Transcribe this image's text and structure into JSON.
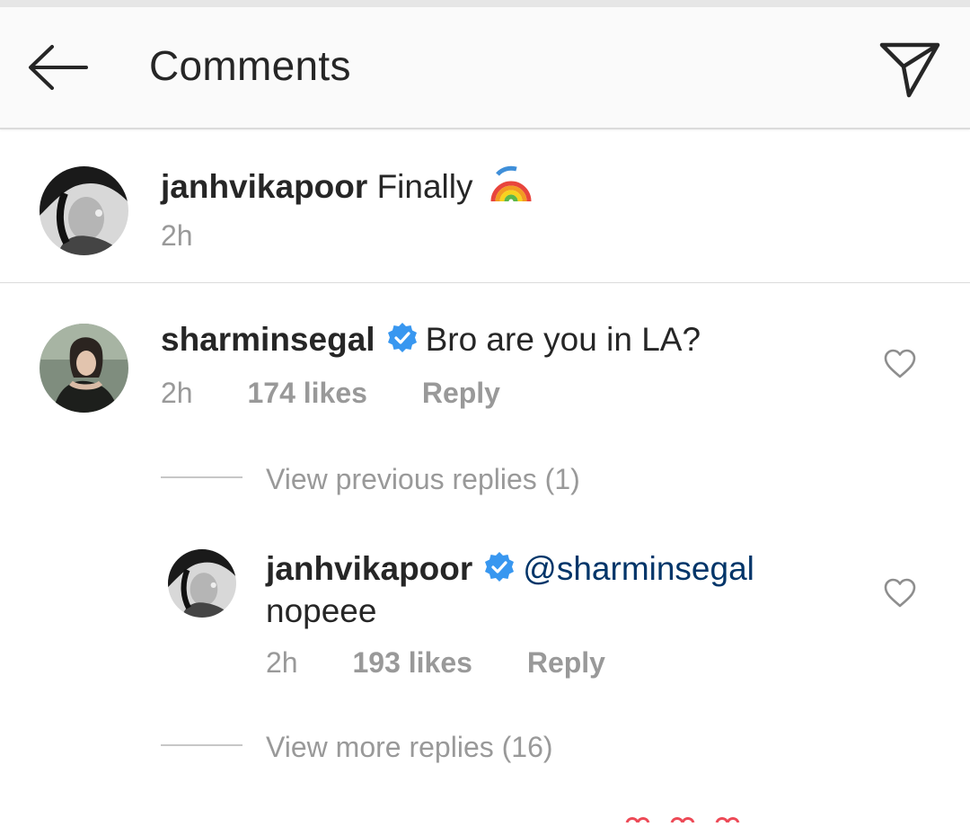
{
  "header": {
    "title": "Comments",
    "back_icon": "arrow-left-icon",
    "share_icon": "paper-plane-icon"
  },
  "caption": {
    "username": "janhvikapoor",
    "text": "Finally",
    "emoji": "rainbow-emoji",
    "time": "2h"
  },
  "comment": {
    "username": "sharminsegal",
    "verified": true,
    "text": "Bro are you in LA?",
    "time": "2h",
    "likes": "174 likes",
    "reply_label": "Reply"
  },
  "view_previous": {
    "label": "View previous replies (1)"
  },
  "reply": {
    "username": "janhvikapoor",
    "verified": true,
    "mention": "@sharminsegal",
    "text": "nopeee",
    "time": "2h",
    "likes": "193 likes",
    "reply_label": "Reply"
  },
  "view_more": {
    "label": "View more replies (16)"
  },
  "colors": {
    "verified_badge": "#3897f0",
    "mention": "#003569",
    "muted": "#999999",
    "text": "#262626",
    "header_bg": "#fafafa"
  }
}
